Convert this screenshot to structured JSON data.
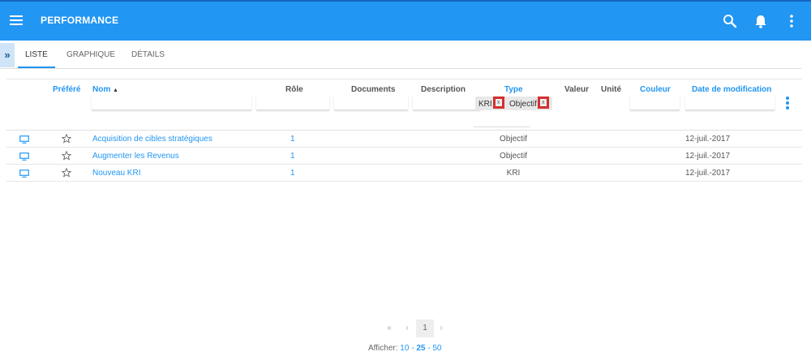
{
  "app": {
    "title": "PERFORMANCE",
    "accent_color": "#2196f3",
    "icons": [
      "menu-icon",
      "search-icon",
      "bell-icon",
      "more-vert-icon"
    ]
  },
  "sidebar_toggle": {
    "label": "»"
  },
  "tabs": [
    {
      "label": "LISTE",
      "active": true
    },
    {
      "label": "GRAPHIQUE",
      "active": false
    },
    {
      "label": "DÉTAILS",
      "active": false
    }
  ],
  "table": {
    "columns": {
      "favorite": "Préféré",
      "name": "Nom",
      "sort_indicator": "▲",
      "role": "Rôle",
      "documents": "Documents",
      "description": "Description",
      "type": "Type",
      "value": "Valeur",
      "unit": "Unité",
      "color": "Couleur",
      "modified": "Date de modification"
    },
    "type_filter_chips": [
      {
        "label": "KRI",
        "remove": "x"
      },
      {
        "label": "Objectif",
        "remove": "x"
      }
    ],
    "rows": [
      {
        "name": "Acquisition de cibles stratégiques",
        "role": "1",
        "type": "Objectif",
        "modified": "12-juil.-2017"
      },
      {
        "name": "Augmenter les Revenus",
        "role": "1",
        "type": "Objectif",
        "modified": "12-juil.-2017"
      },
      {
        "name": "Nouveau KRI",
        "role": "1",
        "type": "KRI",
        "modified": "12-juil.-2017"
      }
    ]
  },
  "pagination": {
    "first": "«",
    "prev": "‹",
    "current": "1",
    "next": "›",
    "show_label": "Afficher:",
    "page_sizes": [
      "10",
      "25",
      "50"
    ],
    "selected_page_size": "25",
    "separator": "-"
  }
}
